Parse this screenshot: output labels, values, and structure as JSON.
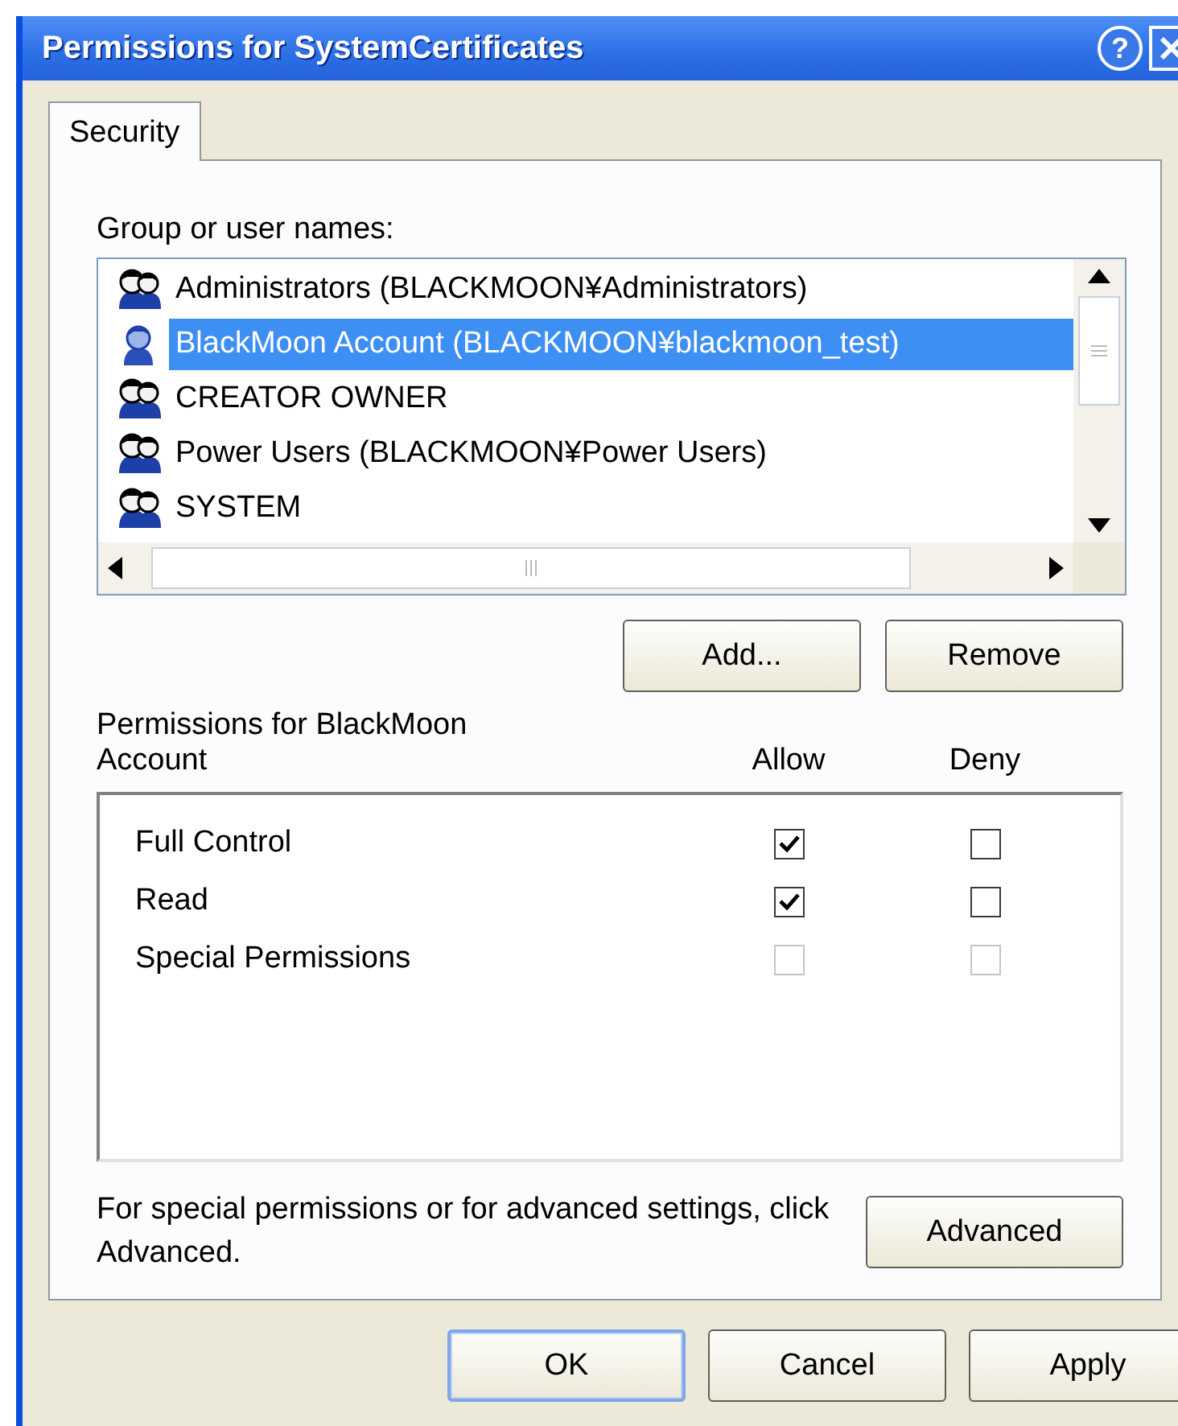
{
  "window": {
    "title": "Permissions for SystemCertificates",
    "help_button": "?"
  },
  "tabs": [
    {
      "label": "Security",
      "selected": true
    }
  ],
  "group_label": "Group or user names:",
  "users": [
    {
      "kind": "group",
      "name": "Administrators (BLACKMOON¥Administrators)",
      "selected": false
    },
    {
      "kind": "user",
      "name": "BlackMoon Account (BLACKMOON¥blackmoon_test)",
      "selected": true
    },
    {
      "kind": "group",
      "name": "CREATOR OWNER",
      "selected": false
    },
    {
      "kind": "group",
      "name": "Power Users (BLACKMOON¥Power Users)",
      "selected": false
    },
    {
      "kind": "group",
      "name": "SYSTEM",
      "selected": false
    }
  ],
  "list_buttons": [
    "Add...",
    "Remove"
  ],
  "permissions": {
    "label": "Permissions for BlackMoon Account",
    "allow_header": "Allow",
    "deny_header": "Deny",
    "rows": [
      {
        "name": "Full Control",
        "allow": true,
        "deny": false,
        "disabled": false
      },
      {
        "name": "Read",
        "allow": true,
        "deny": false,
        "disabled": false
      },
      {
        "name": "Special Permissions",
        "allow": false,
        "deny": false,
        "disabled": true
      }
    ]
  },
  "advanced": {
    "text": "For special permissions or for advanced settings, click Advanced.",
    "button": "Advanced"
  },
  "buttons": [
    {
      "label": "OK",
      "default": true
    },
    {
      "label": "Cancel",
      "default": false
    },
    {
      "label": "Apply",
      "default": false
    }
  ]
}
